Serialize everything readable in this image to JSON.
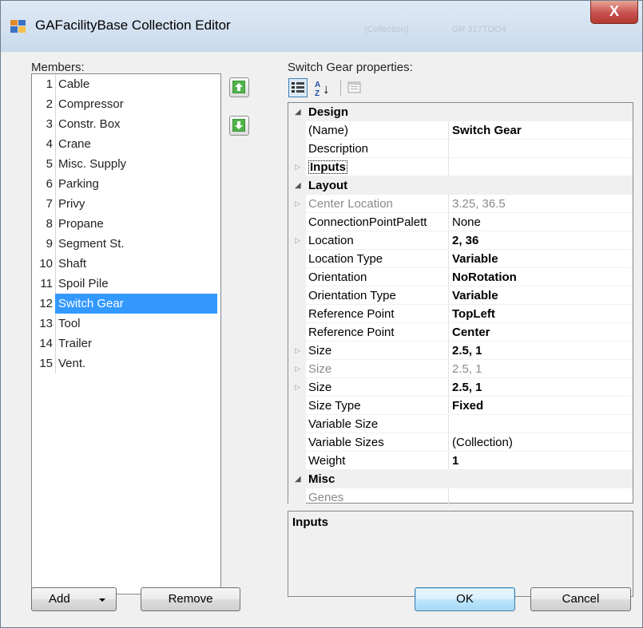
{
  "window": {
    "title": "GAFacilityBase Collection Editor",
    "close_glyph": "X",
    "background_ghost": [
      "(Collection)",
      "GR 317TOO4"
    ]
  },
  "members": {
    "label": "Members:",
    "items": [
      {
        "num": "1",
        "name": "Cable"
      },
      {
        "num": "2",
        "name": "Compressor"
      },
      {
        "num": "3",
        "name": "Constr. Box"
      },
      {
        "num": "4",
        "name": "Crane"
      },
      {
        "num": "5",
        "name": "Misc. Supply"
      },
      {
        "num": "6",
        "name": "Parking"
      },
      {
        "num": "7",
        "name": "Privy"
      },
      {
        "num": "8",
        "name": "Propane"
      },
      {
        "num": "9",
        "name": "Segment St."
      },
      {
        "num": "10",
        "name": "Shaft"
      },
      {
        "num": "11",
        "name": "Spoil Pile"
      },
      {
        "num": "12",
        "name": "Switch Gear",
        "selected": true
      },
      {
        "num": "13",
        "name": "Tool"
      },
      {
        "num": "14",
        "name": "Trailer"
      },
      {
        "num": "15",
        "name": "Vent."
      }
    ]
  },
  "move_buttons": {
    "up_icon": "green-up-arrow-icon",
    "down_icon": "green-down-arrow-icon"
  },
  "properties": {
    "label": "Switch Gear properties:",
    "toolbar": [
      "categorized-icon",
      "alphabetical-icon",
      "property-pages-icon"
    ],
    "alphabetical_glyph": {
      "a": "A",
      "z": "Z",
      "arrow": "↓"
    },
    "rows": [
      {
        "type": "category",
        "name": "Design"
      },
      {
        "type": "prop",
        "name": "(Name)",
        "value": "Switch Gear",
        "bold": true
      },
      {
        "type": "prop",
        "name": "Description",
        "value": ""
      },
      {
        "type": "expander",
        "name": "Inputs",
        "value": "",
        "focused": true
      },
      {
        "type": "category",
        "name": "Layout"
      },
      {
        "type": "expander",
        "name": "Center Location",
        "value": "3.25, 36.5",
        "readonly": true
      },
      {
        "type": "prop",
        "name": "ConnectionPointPalett",
        "value": "None"
      },
      {
        "type": "expander",
        "name": "Location",
        "value": "2, 36",
        "bold": true
      },
      {
        "type": "prop",
        "name": "Location Type",
        "value": "Variable",
        "bold": true
      },
      {
        "type": "prop",
        "name": "Orientation",
        "value": "NoRotation",
        "bold": true
      },
      {
        "type": "prop",
        "name": "Orientation Type",
        "value": "Variable",
        "bold": true
      },
      {
        "type": "prop",
        "name": "Reference Point",
        "value": "TopLeft",
        "bold": true
      },
      {
        "type": "prop",
        "name": "Reference Point",
        "value": "Center",
        "bold": true
      },
      {
        "type": "expander",
        "name": "Size",
        "value": "2.5, 1",
        "bold": true
      },
      {
        "type": "expander",
        "name": "Size",
        "value": "2.5, 1",
        "readonly": true
      },
      {
        "type": "expander",
        "name": "Size",
        "value": "2.5, 1",
        "bold": true
      },
      {
        "type": "prop",
        "name": "Size Type",
        "value": "Fixed",
        "bold": true
      },
      {
        "type": "prop",
        "name": "Variable Size",
        "value": ""
      },
      {
        "type": "prop",
        "name": "Variable Sizes",
        "value": "(Collection)"
      },
      {
        "type": "prop",
        "name": "Weight",
        "value": "1",
        "bold": true
      },
      {
        "type": "category",
        "name": "Misc"
      },
      {
        "type": "prop",
        "name": "Genes",
        "value": "",
        "readonly": true
      }
    ],
    "description_title": "Inputs"
  },
  "buttons": {
    "add": "Add",
    "remove": "Remove",
    "ok": "OK",
    "cancel": "Cancel"
  }
}
